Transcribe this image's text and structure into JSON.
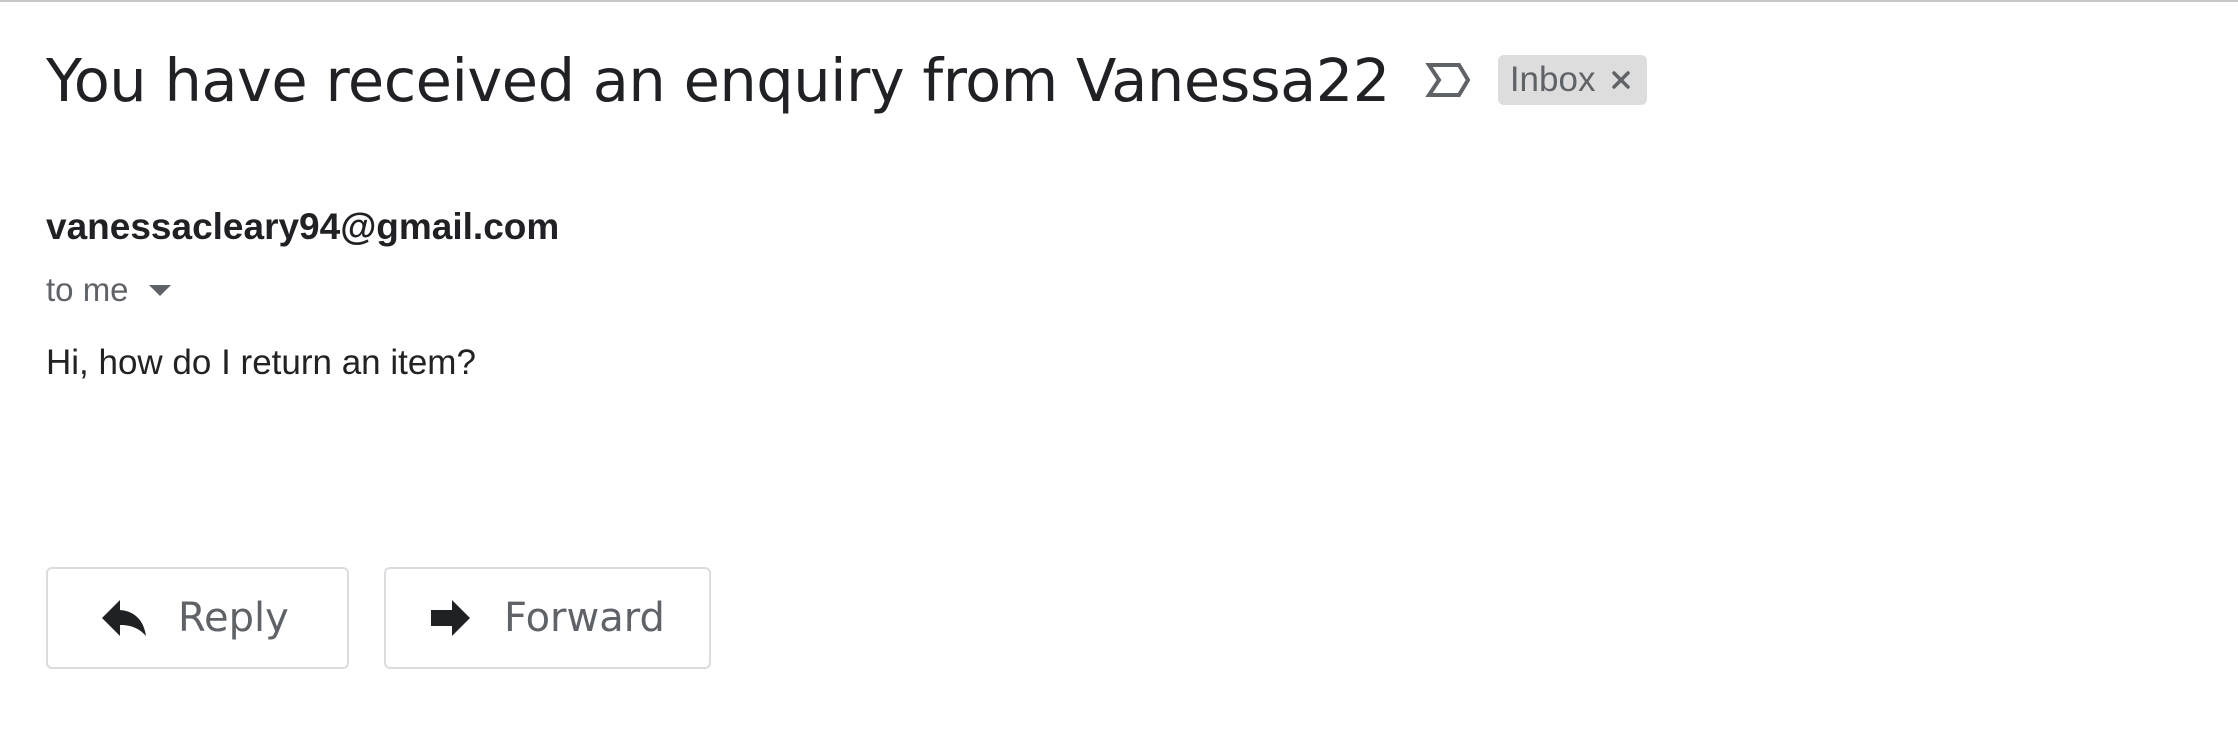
{
  "email": {
    "subject": "You have received an enquiry from Vanessa22",
    "label": "Inbox",
    "sender": "vanessacleary94@gmail.com",
    "recipient": "to me",
    "body": "Hi, how do I return an item?"
  },
  "actions": {
    "reply_label": "Reply",
    "forward_label": "Forward"
  },
  "icons": {
    "importance": "importance-marker-icon",
    "label_remove": "close-icon",
    "recipient_details": "chevron-down-icon",
    "reply": "reply-icon",
    "forward": "forward-icon"
  },
  "colors": {
    "text_primary": "#202124",
    "text_secondary": "#5f6368",
    "label_chip_background": "#dddddd",
    "button_border": "#dadce0"
  }
}
